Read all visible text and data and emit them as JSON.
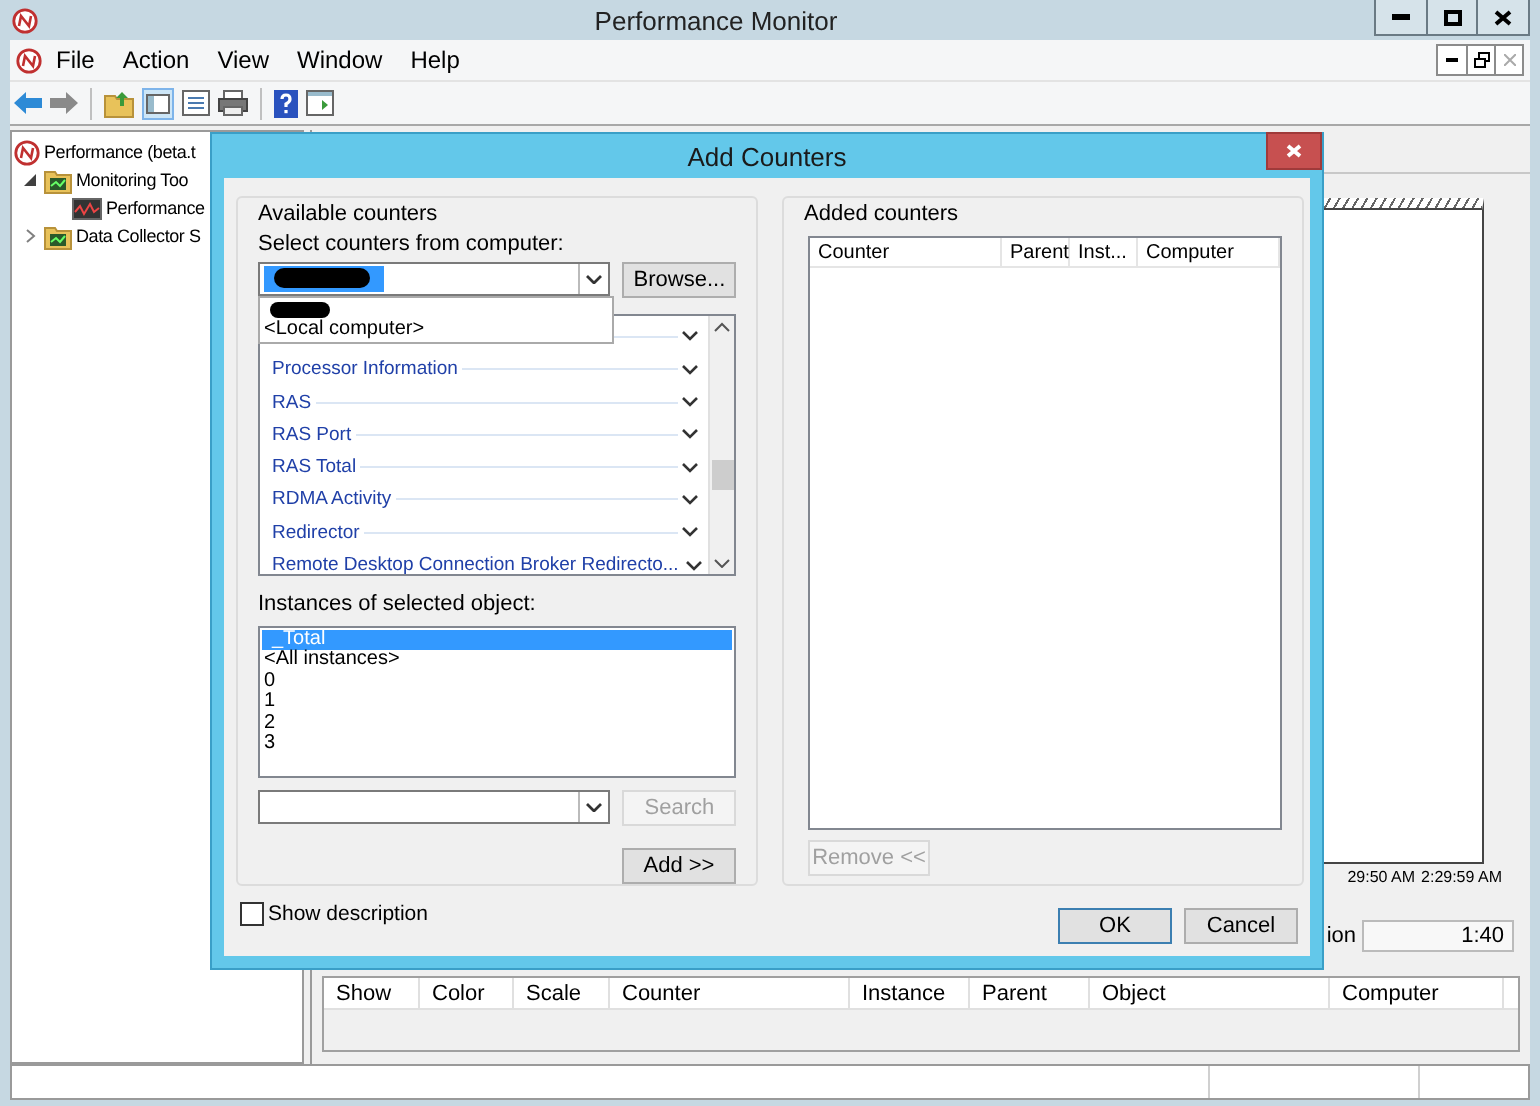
{
  "app": {
    "title": "Performance Monitor",
    "menu": [
      "File",
      "Action",
      "View",
      "Window",
      "Help"
    ]
  },
  "tree": [
    {
      "label": "Performance (beta.t",
      "children": [
        {
          "label": "Monitoring Too",
          "expanded": true,
          "children": [
            {
              "label": "Performance"
            }
          ]
        },
        {
          "label": "Data Collector S",
          "expanded": false
        }
      ]
    }
  ],
  "graph": {
    "time_labels": [
      "29:50 AM",
      "2:29:59 AM"
    ],
    "duration_label": "ion",
    "duration_value": "1:40"
  },
  "counter_table": {
    "columns": [
      "Show",
      "Color",
      "Scale",
      "Counter",
      "Instance",
      "Parent",
      "Object",
      "Computer"
    ]
  },
  "dialog": {
    "title": "Add Counters",
    "available": {
      "group_label": "Available counters",
      "computer_label": "Select counters from computer:",
      "computer_value": {
        "kind": "redacted"
      },
      "computer_options": [
        {
          "kind": "redacted"
        },
        {
          "kind": "text",
          "label": "<Local computer>"
        }
      ],
      "browse_button": {
        "label": "Browse...",
        "disabled": false
      },
      "counters": [
        {
          "expanded": false
        },
        {
          "label": "Processor Information",
          "expanded": false
        },
        {
          "label": "RAS",
          "expanded": false
        },
        {
          "label": "RAS Port",
          "expanded": false
        },
        {
          "label": "RAS Total",
          "expanded": false
        },
        {
          "label": "RDMA Activity",
          "expanded": false
        },
        {
          "label": "Redirector",
          "expanded": false
        },
        {
          "label": "Remote Desktop Connection Broker Redirecto...",
          "expanded": false
        }
      ],
      "instances_label": "Instances of selected object:",
      "instances": [
        {
          "label": "_Total",
          "selected": true
        },
        {
          "label": "<All instances>",
          "selected": false
        },
        {
          "label": "0",
          "selected": false
        },
        {
          "label": "1",
          "selected": false
        },
        {
          "label": "2",
          "selected": false
        },
        {
          "label": "3",
          "selected": false
        }
      ],
      "search_button": {
        "label": "Search",
        "disabled": true
      },
      "add_button": {
        "label": "Add >>",
        "disabled": false
      }
    },
    "added": {
      "group_label": "Added counters",
      "columns": [
        "Counter",
        "Parent",
        "Inst...",
        "Computer"
      ],
      "remove_button": {
        "label": "Remove <<",
        "disabled": true
      }
    },
    "show_description": {
      "label": "Show description",
      "checked": false
    },
    "buttons": [
      {
        "label": "OK",
        "disabled": false
      },
      {
        "label": "Cancel",
        "disabled": false
      }
    ]
  }
}
